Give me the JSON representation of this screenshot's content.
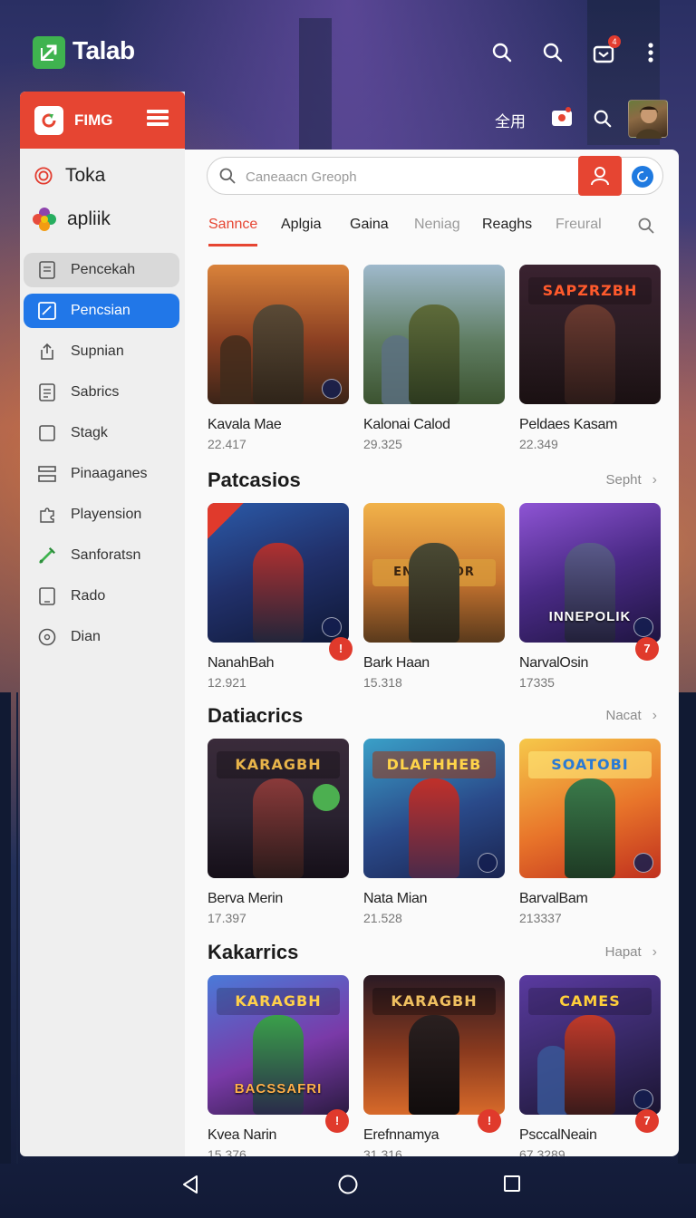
{
  "app": {
    "title": "Talab",
    "notification_count": "4",
    "subbar_label": "全用"
  },
  "sidebar": {
    "header_label": "FIMG",
    "top_items": [
      {
        "label": "Toka",
        "icon": "target-icon"
      },
      {
        "label": "apliik",
        "icon": "flower-icon"
      }
    ],
    "items": [
      {
        "label": "Pencekah",
        "icon": "document-icon",
        "state": "muted"
      },
      {
        "label": "Pencsian",
        "icon": "edit-square-icon",
        "state": "active"
      },
      {
        "label": "Supnian",
        "icon": "share-icon",
        "state": ""
      },
      {
        "label": "Sabrics",
        "icon": "list-icon",
        "state": ""
      },
      {
        "label": "Stagk",
        "icon": "square-icon",
        "state": ""
      },
      {
        "label": "Pinaaganes",
        "icon": "layout-icon",
        "state": ""
      },
      {
        "label": "Playension",
        "icon": "puzzle-icon",
        "state": ""
      },
      {
        "label": "Sanforatsn",
        "icon": "sword-icon",
        "state": ""
      },
      {
        "label": "Rado",
        "icon": "tablet-icon",
        "state": ""
      },
      {
        "label": "Dian",
        "icon": "clock-icon",
        "state": ""
      }
    ]
  },
  "search": {
    "placeholder": "Caneaacn Greoph"
  },
  "tabs": [
    {
      "label": "Sannce",
      "state": "active"
    },
    {
      "label": "Aplgia",
      "state": ""
    },
    {
      "label": "Gaina",
      "state": ""
    },
    {
      "label": "Neniag",
      "state": "dim"
    },
    {
      "label": "Reaghs",
      "state": ""
    },
    {
      "label": "Freural",
      "state": "dim"
    }
  ],
  "sections": [
    {
      "title": "",
      "link": "",
      "cards": [
        {
          "name": "Kavala Mae",
          "count": "22.417",
          "badge": ""
        },
        {
          "name": "Kalonai Calod",
          "count": "29.325",
          "badge": ""
        },
        {
          "name": "Peldaes Kasam",
          "count": "22.349",
          "badge": "",
          "banner": "SAPZRZBH"
        }
      ]
    },
    {
      "title": "Patcasios",
      "link": "Sepht",
      "cards": [
        {
          "name": "NanahBah",
          "count": "12.921",
          "badge": "!"
        },
        {
          "name": "Bark Haan",
          "count": "15.318",
          "badge": "",
          "banner": "ENIASHIOR"
        },
        {
          "name": "NarvalOsin",
          "count": "17335",
          "badge": "7",
          "overlay": "INNEPOLIK"
        }
      ]
    },
    {
      "title": "Datiacrics",
      "link": "Nacat",
      "cards": [
        {
          "name": "Berva Merin",
          "count": "17.397",
          "badge": "",
          "banner": "KARAGBH"
        },
        {
          "name": "Nata Mian",
          "count": "21.528",
          "badge": "",
          "banner": "DLAFHHEB"
        },
        {
          "name": "BarvalBam",
          "count": "213337",
          "badge": "",
          "banner": "SOATOBI"
        }
      ]
    },
    {
      "title": "Kakarrics",
      "link": "Hapat",
      "cards": [
        {
          "name": "Kvea Narin",
          "count": "15.376",
          "badge": "!",
          "banner": "KARAGBH",
          "overlay": "BACSSAFRI"
        },
        {
          "name": "Erefnnamya",
          "count": "31.316",
          "badge": "!",
          "banner": "KARAGBH"
        },
        {
          "name": "PsccalNeain",
          "count": "67.3289",
          "badge": "7",
          "banner": "CAMES"
        }
      ]
    }
  ],
  "colors": {
    "accent": "#e64532",
    "active_blue": "#2177e8",
    "logo_green": "#3fb34f"
  }
}
